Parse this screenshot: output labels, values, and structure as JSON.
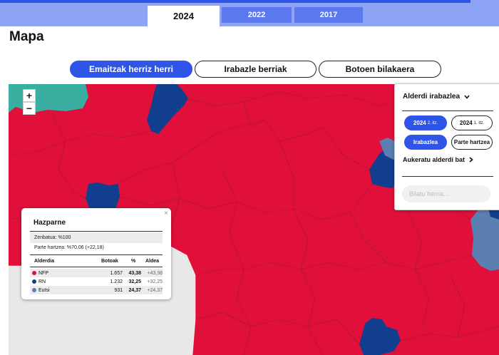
{
  "years": {
    "tabs": [
      {
        "label": "2024",
        "active": true
      },
      {
        "label": "2022",
        "active": false
      },
      {
        "label": "2017",
        "active": false
      }
    ]
  },
  "title": "Mapa",
  "modes": [
    {
      "label": "Emaitzak herriz herri",
      "active": true
    },
    {
      "label": "Irabazle berriak",
      "active": false
    },
    {
      "label": "Botoen bilakaera",
      "active": false
    }
  ],
  "zoom": {
    "in": "+",
    "out": "−"
  },
  "panel": {
    "dropdown_label": "Alderdi irabazlea",
    "round_pills": [
      {
        "label": "2024",
        "sub": "2. itz.",
        "active": true
      },
      {
        "label": "2024",
        "sub": "1. itz.",
        "active": false
      }
    ],
    "metric_pills": [
      {
        "label": "Irabazlea",
        "active": true
      },
      {
        "label": "Parte hartzea",
        "active": false
      }
    ],
    "highlight_label": "Aukeratu alderdi bat",
    "search_placeholder": "Bilatu herria..."
  },
  "tooltip": {
    "close": "×",
    "town": "Hazparne",
    "counted": "Zenbatua: %100",
    "turnout": "Parte hartzea: %70,06 (+22,18)",
    "headers": {
      "party": "Alderdia",
      "votes": "Botoak",
      "pct": "%",
      "diff": "Aldea"
    },
    "rows": [
      {
        "party": "NFP",
        "votes": "1.657",
        "pct": "43,38",
        "diff": "+43,38"
      },
      {
        "party": "RN",
        "votes": "1.232",
        "pct": "32,25",
        "diff": "+32,25"
      },
      {
        "party": "Eutsi",
        "votes": "931",
        "pct": "24,37",
        "diff": "+24,37"
      }
    ]
  },
  "colors": {
    "nfp": "#e0103a",
    "rn": "#123e8e",
    "eutsi": "#5b7fb0",
    "other": "#3aaea0",
    "accent": "#2e55e8",
    "no_data": "#e8e8e8"
  }
}
